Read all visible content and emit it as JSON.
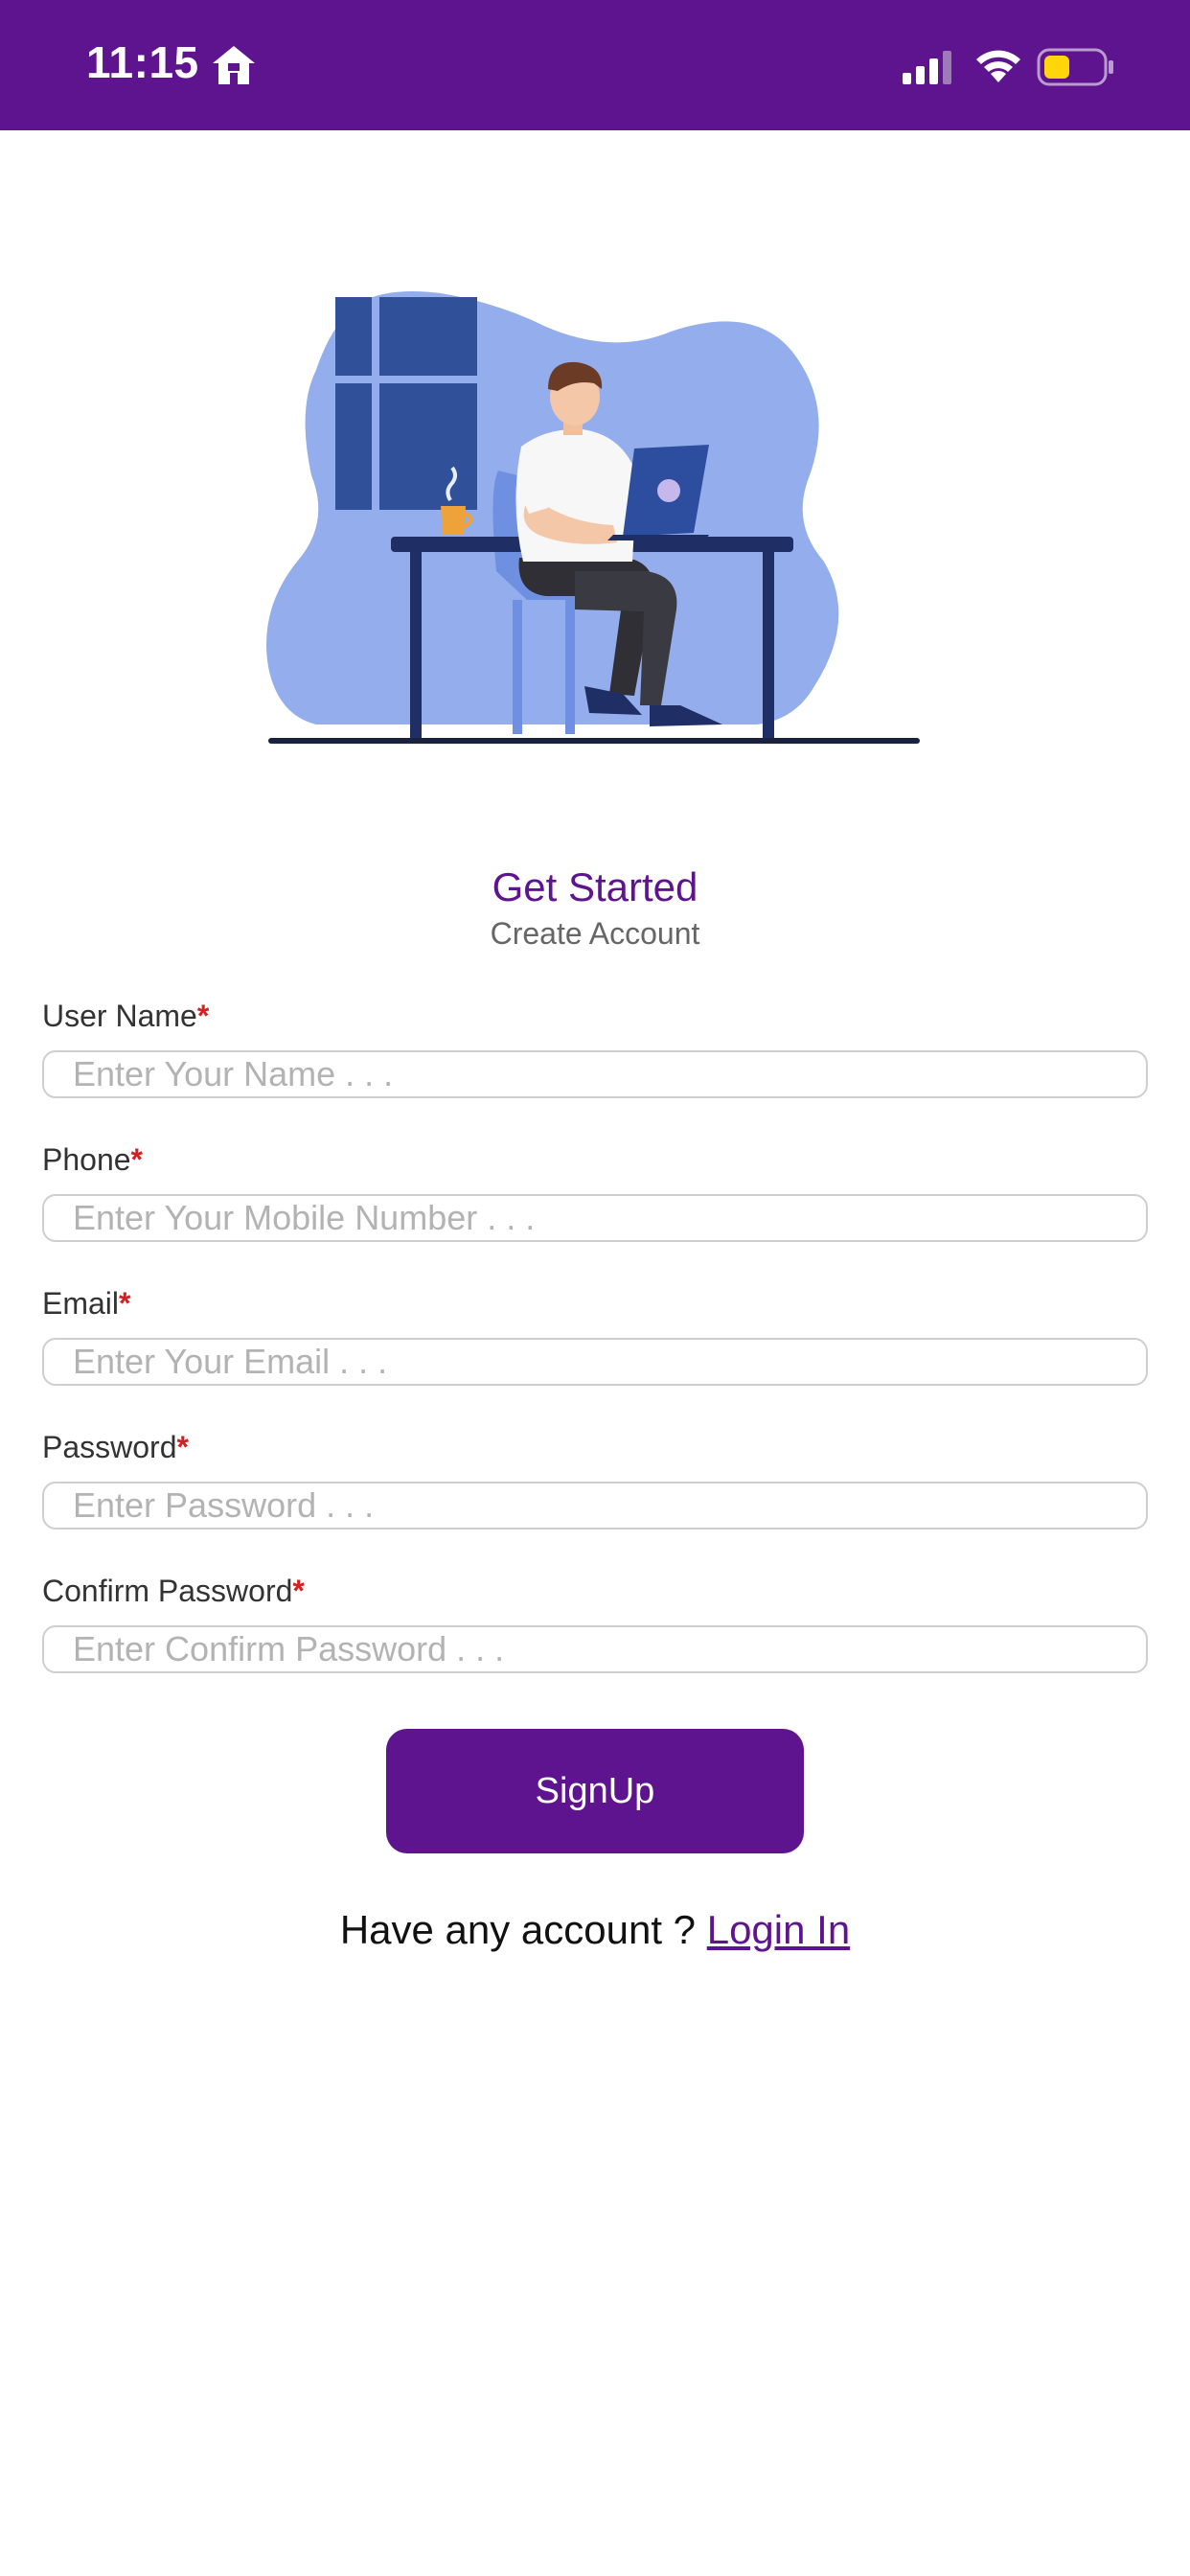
{
  "status_bar": {
    "time": "11:15",
    "icons": [
      "home-icon",
      "signal-icon",
      "wifi-icon",
      "battery-icon"
    ],
    "background": "#5f148f"
  },
  "illustration": {
    "icon": "person-working-at-laptop-illustration"
  },
  "header": {
    "title": "Get Started",
    "subtitle": "Create Account"
  },
  "form": {
    "required_mark": "*",
    "fields": [
      {
        "label": "User Name",
        "placeholder": "Enter Your Name . . .",
        "value": ""
      },
      {
        "label": "Phone",
        "placeholder": "Enter Your Mobile Number . . .",
        "value": ""
      },
      {
        "label": "Email",
        "placeholder": "Enter Your Email . . .",
        "value": ""
      },
      {
        "label": "Password",
        "placeholder": "Enter Password . . .",
        "value": ""
      },
      {
        "label": "Confirm Password",
        "placeholder": "Enter Confirm Password . . .",
        "value": ""
      }
    ],
    "submit_label": "SignUp"
  },
  "footer": {
    "prompt": "Have any account ? ",
    "login_link": "Login In"
  },
  "colors": {
    "accent": "#5f148f",
    "required": "#d32020",
    "input_border": "#cfcfcf",
    "placeholder": "#b3b3b3"
  }
}
